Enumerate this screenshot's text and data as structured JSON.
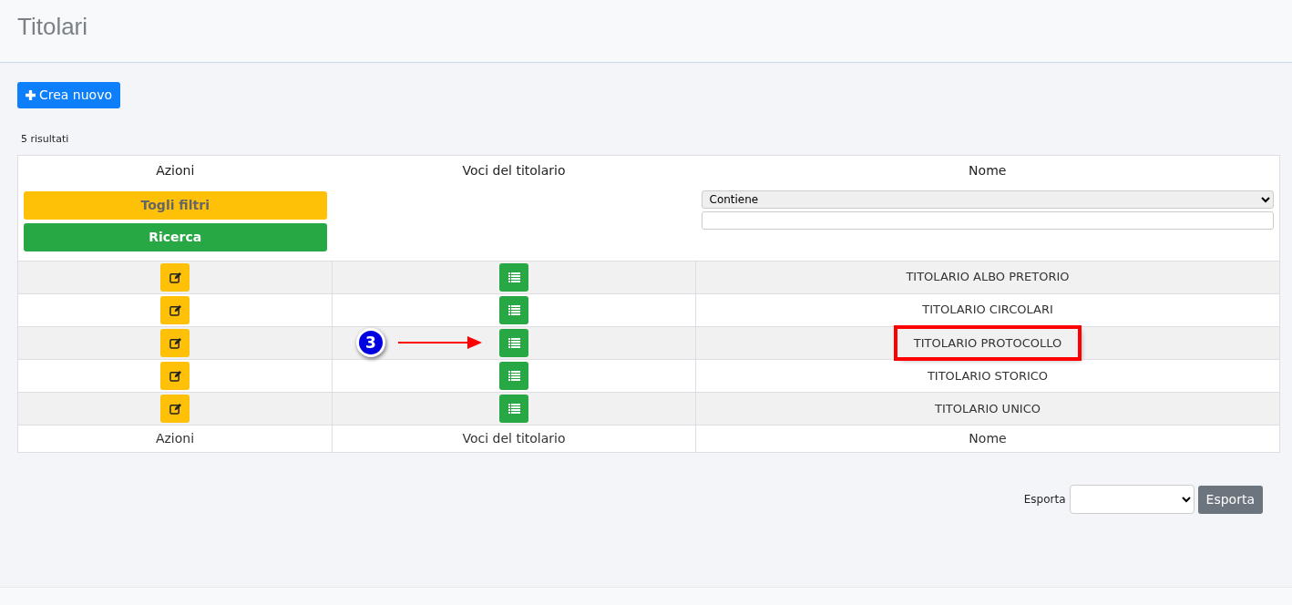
{
  "page_title": "Titolari",
  "create_button": {
    "label": "Crea nuovo"
  },
  "result_count": "5 risultati",
  "table": {
    "columns": [
      "Azioni",
      "Voci del titolario",
      "Nome"
    ],
    "filters": {
      "clear_button": "Togli filtri",
      "search_button": "Ricerca",
      "name_operator": "Contiene"
    },
    "rows": [
      {
        "name": "TITOLARIO ALBO PRETORIO",
        "highlighted": false
      },
      {
        "name": "TITOLARIO CIRCOLARI",
        "highlighted": false
      },
      {
        "name": "TITOLARIO PROTOCOLLO",
        "highlighted": true,
        "callout": "3"
      },
      {
        "name": "TITOLARIO STORICO",
        "highlighted": false
      },
      {
        "name": "TITOLARIO UNICO",
        "highlighted": false
      }
    ],
    "footer_columns": [
      "Azioni",
      "Voci del titolario",
      "Nome"
    ]
  },
  "export": {
    "label": "Esporta",
    "button": "Esporta"
  }
}
